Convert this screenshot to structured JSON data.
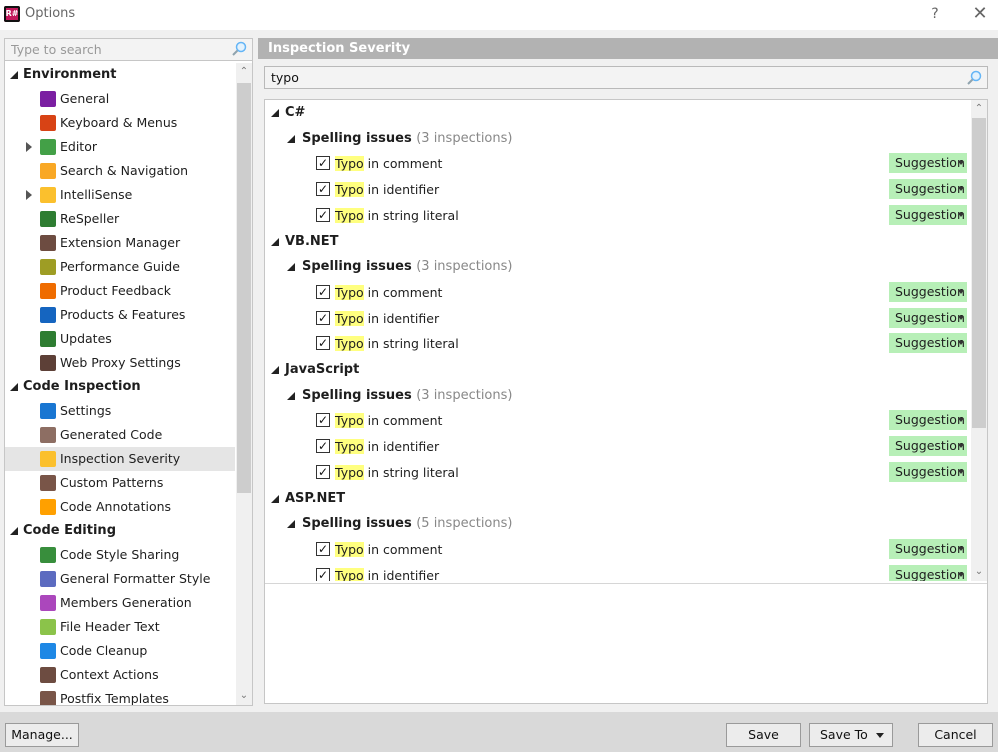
{
  "window": {
    "title": "Options",
    "help": "?",
    "close": "✕",
    "app_icon_text": "R#"
  },
  "left": {
    "search_placeholder": "Type to search",
    "tree": [
      {
        "type": "group",
        "label": "Environment",
        "open": true
      },
      {
        "type": "item",
        "label": "General",
        "icon": "general-icon",
        "color": "#7b1fa2"
      },
      {
        "type": "item",
        "label": "Keyboard & Menus",
        "icon": "keyboard-icon",
        "color": "#d84315"
      },
      {
        "type": "item",
        "label": "Editor",
        "icon": "pencil-icon",
        "color": "#43a047",
        "expandable": true
      },
      {
        "type": "item",
        "label": "Search & Navigation",
        "icon": "magnifier-icon",
        "color": "#f9a825"
      },
      {
        "type": "item",
        "label": "IntelliSense",
        "icon": "lightbulb-icon",
        "color": "#fbc02d",
        "expandable": true
      },
      {
        "type": "item",
        "label": "ReSpeller",
        "icon": "respeller-icon",
        "color": "#2e7d32"
      },
      {
        "type": "item",
        "label": "Extension Manager",
        "icon": "extension-icon",
        "color": "#6d4c41"
      },
      {
        "type": "item",
        "label": "Performance Guide",
        "icon": "performance-icon",
        "color": "#9e9d24"
      },
      {
        "type": "item",
        "label": "Product Feedback",
        "icon": "envelope-icon",
        "color": "#ef6c00"
      },
      {
        "type": "item",
        "label": "Products & Features",
        "icon": "products-icon",
        "color": "#1565c0"
      },
      {
        "type": "item",
        "label": "Updates",
        "icon": "updates-icon",
        "color": "#2e7d32"
      },
      {
        "type": "item",
        "label": "Web Proxy Settings",
        "icon": "proxy-icon",
        "color": "#5d4037"
      },
      {
        "type": "group",
        "label": "Code Inspection",
        "open": true
      },
      {
        "type": "item",
        "label": "Settings",
        "icon": "settings-icon",
        "color": "#1976d2"
      },
      {
        "type": "item",
        "label": "Generated Code",
        "icon": "generated-code-icon",
        "color": "#8d6e63"
      },
      {
        "type": "item",
        "label": "Inspection Severity",
        "icon": "inspection-severity-icon",
        "color": "#fbc02d",
        "selected": true
      },
      {
        "type": "item",
        "label": "Custom Patterns",
        "icon": "custom-patterns-icon",
        "color": "#795548"
      },
      {
        "type": "item",
        "label": "Code Annotations",
        "icon": "code-annotations-icon",
        "color": "#ffa000"
      },
      {
        "type": "group",
        "label": "Code Editing",
        "open": true
      },
      {
        "type": "item",
        "label": "Code Style Sharing",
        "icon": "code-style-sharing-icon",
        "color": "#388e3c"
      },
      {
        "type": "item",
        "label": "General Formatter Style",
        "icon": "formatter-icon",
        "color": "#5c6bc0"
      },
      {
        "type": "item",
        "label": "Members Generation",
        "icon": "members-generation-icon",
        "color": "#ab47bc"
      },
      {
        "type": "item",
        "label": "File Header Text",
        "icon": "file-header-icon",
        "color": "#8bc34a"
      },
      {
        "type": "item",
        "label": "Code Cleanup",
        "icon": "code-cleanup-icon",
        "color": "#1e88e5"
      },
      {
        "type": "item",
        "label": "Context Actions",
        "icon": "context-actions-icon",
        "color": "#6d4c41"
      },
      {
        "type": "item",
        "label": "Postfix Templates",
        "icon": "postfix-icon",
        "color": "#795548"
      }
    ]
  },
  "right": {
    "header": "Inspection Severity",
    "filter_value": "typo",
    "highlight_word": "Typo",
    "languages": [
      {
        "name": "C#",
        "category": "Spelling issues",
        "count": "(3 inspections)",
        "items": [
          {
            "rest": " in comment",
            "severity": "Suggestion"
          },
          {
            "rest": " in identifier",
            "severity": "Suggestion"
          },
          {
            "rest": " in string literal",
            "severity": "Suggestion"
          }
        ]
      },
      {
        "name": "VB.NET",
        "category": "Spelling issues",
        "count": "(3 inspections)",
        "items": [
          {
            "rest": " in comment",
            "severity": "Suggestion"
          },
          {
            "rest": " in identifier",
            "severity": "Suggestion"
          },
          {
            "rest": " in string literal",
            "severity": "Suggestion"
          }
        ]
      },
      {
        "name": "JavaScript",
        "category": "Spelling issues",
        "count": "(3 inspections)",
        "items": [
          {
            "rest": " in comment",
            "severity": "Suggestion"
          },
          {
            "rest": " in identifier",
            "severity": "Suggestion"
          },
          {
            "rest": " in string literal",
            "severity": "Suggestion"
          }
        ]
      },
      {
        "name": "ASP.NET",
        "category": "Spelling issues",
        "count": "(5 inspections)",
        "items": [
          {
            "rest": " in comment",
            "severity": "Suggestion"
          },
          {
            "rest": " in identifier",
            "severity": "Suggestion"
          }
        ]
      }
    ]
  },
  "footer": {
    "manage": "Manage...",
    "save": "Save",
    "save_to": "Save To",
    "cancel": "Cancel"
  }
}
